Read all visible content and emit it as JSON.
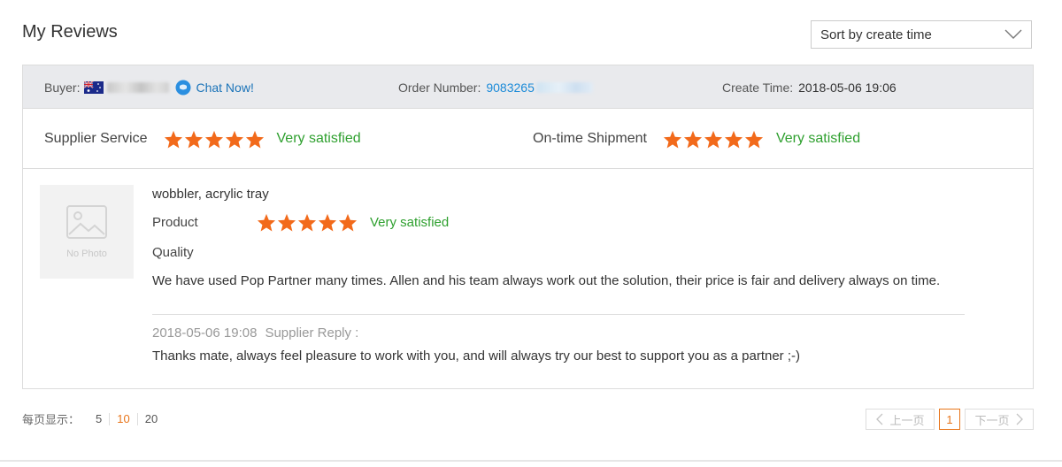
{
  "page": {
    "title": "My Reviews"
  },
  "sort": {
    "label": "Sort by create time",
    "icon": "chevron-down-icon"
  },
  "review": {
    "header": {
      "buyer_label": "Buyer:",
      "chat_label": "Chat Now!",
      "order_label": "Order Number:",
      "order_number_visible": "9083265",
      "create_label": "Create Time:",
      "create_time": "2018-05-06 19:06"
    },
    "ratings": [
      {
        "label": "Supplier Service",
        "stars": 5,
        "text": "Very satisfied"
      },
      {
        "label": "On-time Shipment",
        "stars": 5,
        "text": "Very satisfied"
      }
    ],
    "product": {
      "photo_placeholder": "No Photo",
      "name": "wobbler, acrylic tray",
      "product_label": "Product",
      "product_stars": 5,
      "product_text": "Very satisfied",
      "quality_label": "Quality",
      "review_text": "We have used Pop Partner many times. Allen and his team always work out the solution, their price is fair and delivery always on time.",
      "reply_time": "2018-05-06 19:08",
      "reply_label": "Supplier Reply :",
      "reply_text": "Thanks mate, always feel pleasure to work with you, and will always try our best to support you as a partner ;-)"
    }
  },
  "pagination": {
    "per_page_label": "每页显示：",
    "sizes": [
      "5",
      "10",
      "20"
    ],
    "active_size": "10",
    "prev_label": "上一页",
    "current_page": "1",
    "next_label": "下一页"
  },
  "colors": {
    "accent_orange": "#e8751a",
    "star_orange": "#f26a1b",
    "satisfied_green": "#2fa02f",
    "link_blue": "#1a73b8"
  }
}
